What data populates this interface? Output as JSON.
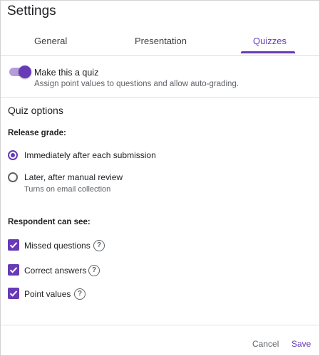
{
  "dialog": {
    "title": "Settings"
  },
  "tabs": [
    {
      "label": "General"
    },
    {
      "label": "Presentation"
    },
    {
      "label": "Quizzes"
    }
  ],
  "quiz_toggle": {
    "label": "Make this a quiz",
    "description": "Assign point values to questions and allow auto-grading.",
    "on": true
  },
  "quiz_options": {
    "title": "Quiz options",
    "release_grade": {
      "label": "Release grade:",
      "options": [
        {
          "label": "Immediately after each submission",
          "sub": "",
          "selected": true
        },
        {
          "label": "Later, after manual review",
          "sub": "Turns on email collection",
          "selected": false
        }
      ]
    },
    "respondent": {
      "label": "Respondent can see:",
      "items": [
        {
          "label": "Missed questions",
          "checked": true
        },
        {
          "label": "Correct answers",
          "checked": true
        },
        {
          "label": "Point values",
          "checked": true
        }
      ]
    }
  },
  "footer": {
    "cancel_label": "Cancel",
    "save_label": "Save"
  },
  "colors": {
    "accent": "#673ab7",
    "accent_light": "#b39ddb",
    "text": "#202124",
    "muted": "#5f6368"
  }
}
